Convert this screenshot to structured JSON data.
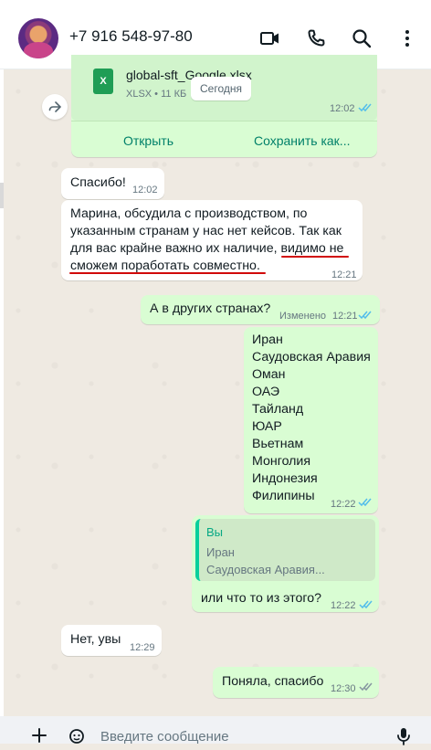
{
  "header": {
    "contact_name": "+7 916 548-97-80",
    "icons": [
      "video-call-icon",
      "phone-icon",
      "search-icon",
      "more-vertical-icon"
    ]
  },
  "file_message": {
    "file_name": "global-sft_Google.xlsx",
    "file_meta": "XLSX • 11 КБ",
    "file_badge": "X",
    "date_chip": "Сегодня",
    "time": "12:02",
    "open_label": "Открыть",
    "save_label": "Сохранить как..."
  },
  "messages": [
    {
      "dir": "in",
      "text": "Спасибо!",
      "time": "12:02"
    },
    {
      "dir": "in",
      "lines": [
        "Марина, обсудила с производством, по",
        "указанным странам у нас нет кейсов. Так как",
        "для вас крайне важно их наличие, видимо не",
        "сможем поработать совместно."
      ],
      "time": "12:21"
    },
    {
      "dir": "out",
      "text": "А в других странах?",
      "edited": "Изменено",
      "time": "12:21"
    },
    {
      "dir": "out",
      "lines": [
        "Иран",
        "Саудовская Аравия",
        "Оман",
        "ОАЭ",
        "Тайланд",
        "ЮАР",
        "Вьетнам",
        "Монголия",
        "Индонезия",
        "Филипины"
      ],
      "time": "12:22"
    },
    {
      "dir": "out",
      "reply_author": "Вы",
      "reply_lines": [
        "Иран",
        "Саудовская Аравия..."
      ],
      "text": "или что то из этого?",
      "time": "12:22"
    },
    {
      "dir": "in",
      "text": "Нет, увы",
      "time": "12:29"
    },
    {
      "dir": "out",
      "text": "Поняла, спасибо",
      "time": "12:30"
    }
  ],
  "input": {
    "placeholder": "Введите сообщение"
  },
  "colors": {
    "chat_bg": "#efeae2",
    "outgoing": "#d9fdd3",
    "incoming": "#ffffff",
    "read_ticks": "#53bdeb",
    "sent_ticks": "#8696a0",
    "link_green": "#008069",
    "annotation_red": "#d10a0a"
  }
}
